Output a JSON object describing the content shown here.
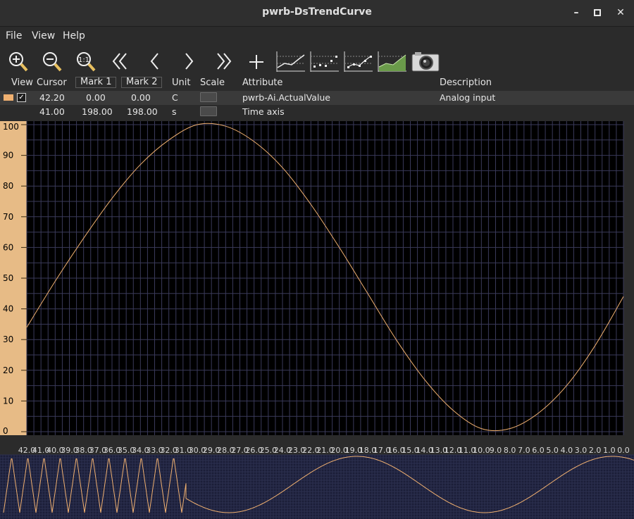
{
  "window": {
    "title": "pwrb-DsTrendCurve"
  },
  "menu": {
    "file": "File",
    "view": "View",
    "help": "Help"
  },
  "toolbar": {
    "buttons": [
      {
        "icon": "zoom-in-icon"
      },
      {
        "icon": "zoom-out-icon"
      },
      {
        "icon": "zoom-reset-icon"
      },
      {
        "icon": "page-left-icon"
      },
      {
        "icon": "scroll-left-icon"
      },
      {
        "icon": "scroll-right-icon"
      },
      {
        "icon": "page-right-icon"
      },
      {
        "icon": "add-icon"
      },
      {
        "icon": "line-chart-icon"
      },
      {
        "icon": "point-chart-icon"
      },
      {
        "icon": "line-point-chart-icon"
      },
      {
        "icon": "fill-chart-icon"
      },
      {
        "icon": "camera-icon"
      }
    ]
  },
  "table": {
    "headers": {
      "view": "View",
      "cursor": "Cursor",
      "mark1": "Mark 1",
      "mark2": "Mark 2",
      "unit": "Unit",
      "scale": "Scale",
      "attribute": "Attribute",
      "description": "Description"
    },
    "rows": [
      {
        "cursor": "42.20",
        "mark1": "0.00",
        "mark2": "0.00",
        "unit": "C",
        "attribute": "pwrb-Ai.ActualValue",
        "description": "Analog input",
        "color": "#f0b070",
        "checked": true
      },
      {
        "cursor": "41.00",
        "mark1": "198.00",
        "mark2": "198.00",
        "unit": "s",
        "attribute": "Time axis",
        "description": ""
      }
    ]
  },
  "chart_data": {
    "type": "line",
    "title": "",
    "xlabel": "",
    "ylabel": "",
    "ylim": [
      0,
      100
    ],
    "y_ticks": [
      "100",
      "90",
      "80",
      "70",
      "60",
      "50",
      "40",
      "30",
      "20",
      "10",
      "0"
    ],
    "x_ticks": [
      "42.0",
      "41.0",
      "40.0",
      "39.0",
      "38.0",
      "37.0",
      "36.0",
      "35.0",
      "34.0",
      "33.0",
      "32.0",
      "31.0",
      "30.0",
      "29.0",
      "28.0",
      "27.0",
      "26.0",
      "25.0",
      "24.0",
      "23.0",
      "22.0",
      "21.0",
      "20.0",
      "19.0",
      "18.0",
      "17.0",
      "16.0",
      "15.0",
      "14.0",
      "13.0",
      "12.0",
      "11.0",
      "10.0",
      "9.0",
      "8.0",
      "7.0",
      "6.0",
      "5.0",
      "4.0",
      "3.0",
      "2.0",
      "1.0",
      "0.0"
    ],
    "xlim": [
      42,
      0
    ],
    "grid": true,
    "series_color": "#f0b070",
    "series": [
      {
        "x": [
          42,
          40,
          38,
          36,
          34,
          32,
          30,
          28,
          26,
          24,
          22,
          20,
          18,
          16,
          14,
          12,
          10,
          8,
          6,
          4,
          2,
          0
        ],
        "values": [
          34,
          49,
          63,
          76,
          87,
          95,
          100,
          99.5,
          94.5,
          86,
          74,
          60,
          45,
          30,
          17,
          7,
          1,
          1,
          6,
          15,
          28,
          44
        ]
      }
    ]
  },
  "overview": {
    "background": "#1b1e38",
    "line_color": "#f0b070"
  }
}
